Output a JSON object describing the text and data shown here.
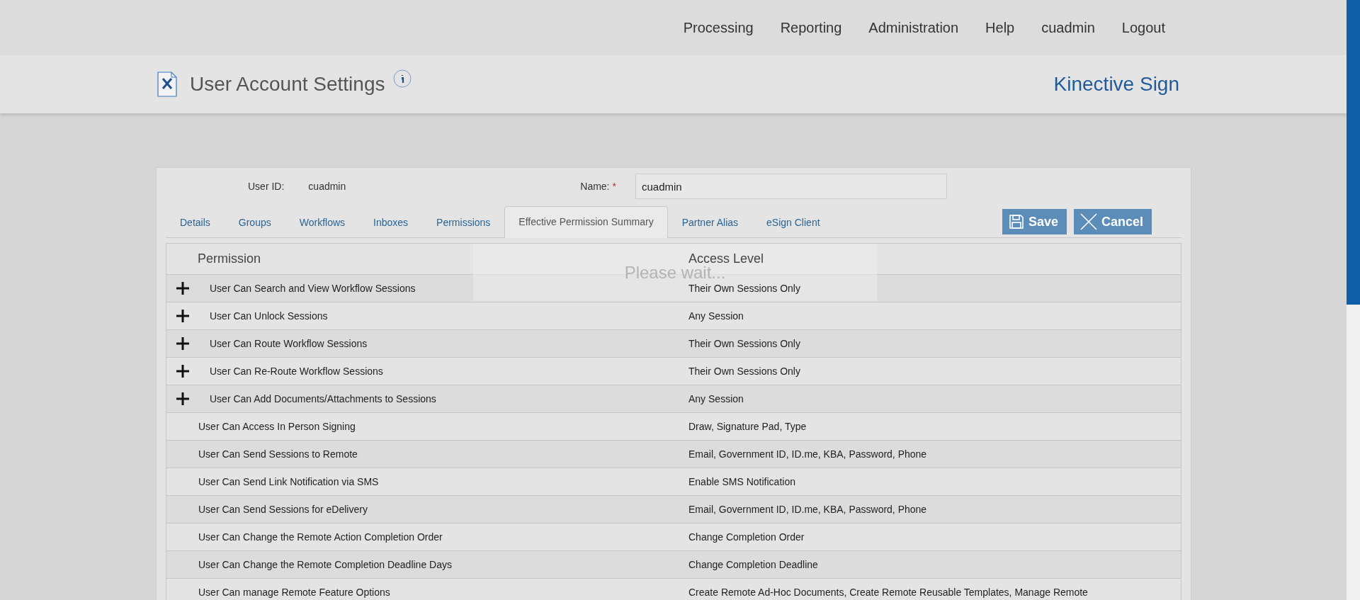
{
  "nav": [
    "Processing",
    "Reporting",
    "Administration",
    "Help",
    "cuadmin",
    "Logout"
  ],
  "header": {
    "title": "User Account Settings",
    "brand": "Kinective Sign"
  },
  "user": {
    "id_label": "User ID:",
    "id_value": "cuadmin",
    "name_label": "Name:",
    "required_mark": "*",
    "name_value": "cuadmin"
  },
  "tabs": [
    {
      "label": "Details",
      "selected": false
    },
    {
      "label": "Groups",
      "selected": false
    },
    {
      "label": "Workflows",
      "selected": false
    },
    {
      "label": "Inboxes",
      "selected": false
    },
    {
      "label": "Permissions",
      "selected": false
    },
    {
      "label": "Effective Permission Summary",
      "selected": true
    },
    {
      "label": "Partner Alias",
      "selected": false
    },
    {
      "label": "eSign Client",
      "selected": false
    }
  ],
  "buttons": [
    {
      "label": "Save",
      "kind": "save"
    },
    {
      "label": "Cancel",
      "kind": "cancel"
    }
  ],
  "loading": "Please wait...",
  "table": {
    "columns": [
      "Permission",
      "Access Level"
    ],
    "rows": [
      {
        "permission": "User Can Search and View Workflow Sessions",
        "access": "Their Own Sessions Only",
        "expandable": true
      },
      {
        "permission": "User Can Unlock Sessions",
        "access": "Any Session",
        "expandable": true
      },
      {
        "permission": "User Can Route Workflow Sessions",
        "access": "Their Own Sessions Only",
        "expandable": true
      },
      {
        "permission": "User Can Re-Route Workflow Sessions",
        "access": "Their Own Sessions Only",
        "expandable": true
      },
      {
        "permission": "User Can Add Documents/Attachments to Sessions",
        "access": "Any Session",
        "expandable": true
      },
      {
        "permission": "User Can Access In Person Signing",
        "access": "Draw, Signature Pad, Type",
        "expandable": false
      },
      {
        "permission": "User Can Send Sessions to Remote",
        "access": "Email, Government ID, ID.me, KBA, Password, Phone",
        "expandable": false
      },
      {
        "permission": "User Can Send Link Notification via SMS",
        "access": "Enable SMS Notification",
        "expandable": false
      },
      {
        "permission": "User Can Send Sessions for eDelivery",
        "access": "Email, Government ID, ID.me, KBA, Password, Phone",
        "expandable": false
      },
      {
        "permission": "User Can Change the Remote Action Completion Order",
        "access": "Change Completion Order",
        "expandable": false
      },
      {
        "permission": "User Can Change the Remote Completion Deadline Days",
        "access": "Change Completion Deadline",
        "expandable": false
      },
      {
        "permission": "User Can manage Remote Feature Options",
        "access": "Create Remote Ad-Hoc Documents, Create Remote Reusable Templates, Manage Remote",
        "expandable": false
      }
    ]
  }
}
